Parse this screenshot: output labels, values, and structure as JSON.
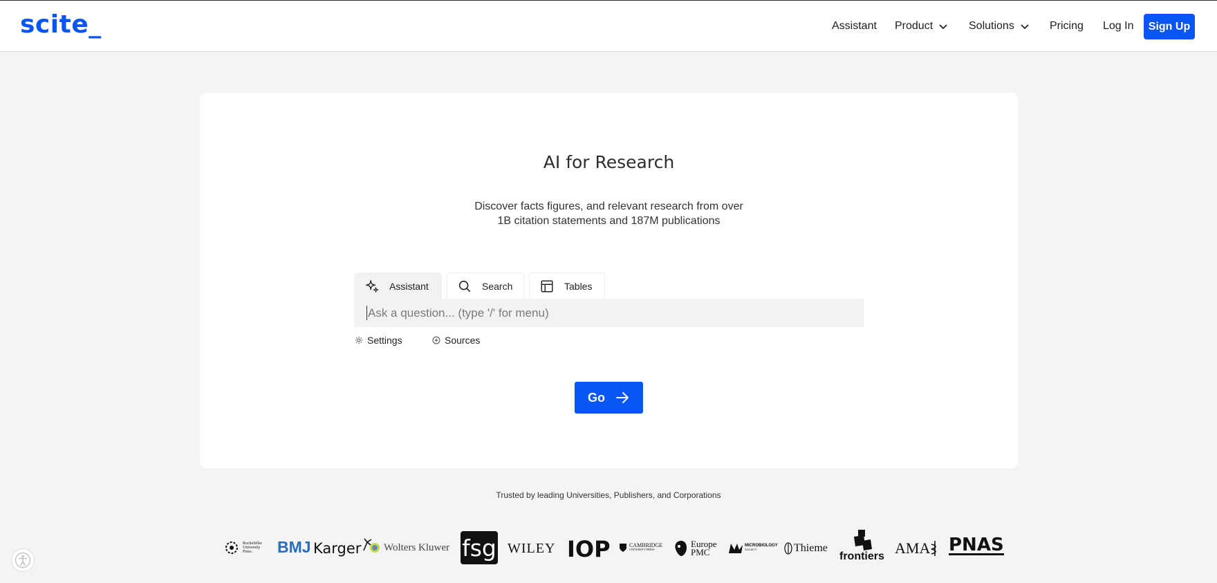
{
  "header": {
    "logo": "scite_",
    "nav": {
      "assistant": "Assistant",
      "product": "Product",
      "solutions": "Solutions",
      "pricing": "Pricing",
      "login": "Log In",
      "signup": "Sign Up"
    }
  },
  "hero": {
    "title": "AI for Research",
    "subtitle_line1": "Discover facts figures, and relevant research from over",
    "subtitle_line2": "1B citation statements and 187M publications"
  },
  "tabs": [
    {
      "label": "Assistant",
      "icon": "sparkle-icon",
      "active": true
    },
    {
      "label": "Search",
      "icon": "search-icon",
      "active": false
    },
    {
      "label": "Tables",
      "icon": "table-icon",
      "active": false
    }
  ],
  "search": {
    "placeholder": "Ask a question... (type '/' for menu)",
    "value": ""
  },
  "options": {
    "settings": "Settings",
    "sources": "Sources"
  },
  "go_button": "Go",
  "trusted_text": "Trusted by leading Universities, Publishers, and Corporations",
  "partner_logos": [
    {
      "name": "Rockefeller University Press",
      "text_lines": [
        "Rockefeller",
        "University",
        "Press"
      ]
    },
    {
      "name": "BMJ",
      "text": "BMJ"
    },
    {
      "name": "Karger",
      "text": "Karger"
    },
    {
      "name": "Wolters Kluwer",
      "text": "Wolters Kluwer"
    },
    {
      "name": "fsg",
      "text": "fsg"
    },
    {
      "name": "Wiley",
      "text": "WILEY"
    },
    {
      "name": "IOP",
      "text": "IOP"
    },
    {
      "name": "Cambridge University Press",
      "text": "CAMBRIDGE",
      "subtext": "UNIVERSITY PRESS"
    },
    {
      "name": "Europe PMC",
      "text_lines": [
        "Europe",
        "PMC"
      ]
    },
    {
      "name": "Microbiology Society",
      "text": "MICROBIOLOGY",
      "subtext": "SOCIETY"
    },
    {
      "name": "Thieme",
      "text": "Thieme"
    },
    {
      "name": "frontiers",
      "text": "frontiers"
    },
    {
      "name": "AMA",
      "text": "AMA"
    },
    {
      "name": "PNAS",
      "text": "PNAS"
    }
  ],
  "colors": {
    "brand_blue": "#0a55f5",
    "page_bg": "#f4f4f4"
  }
}
